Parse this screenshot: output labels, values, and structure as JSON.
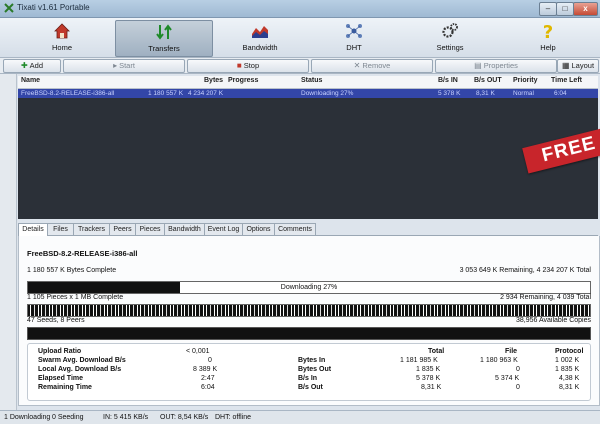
{
  "window": {
    "title": "Tixati v1.61 Portable",
    "min": "–",
    "max": "□",
    "close": "x"
  },
  "toolbar": [
    {
      "key": "home",
      "label": "Home",
      "icon": "home-icon"
    },
    {
      "key": "transfers",
      "label": "Transfers",
      "icon": "transfers-icon",
      "active": true
    },
    {
      "key": "bandwidth",
      "label": "Bandwidth",
      "icon": "bandwidth-icon"
    },
    {
      "key": "dht",
      "label": "DHT",
      "icon": "dht-icon"
    },
    {
      "key": "settings",
      "label": "Settings",
      "icon": "settings-icon"
    },
    {
      "key": "help",
      "label": "Help",
      "icon": "help-icon"
    }
  ],
  "actions": {
    "add": "Add",
    "start": "Start",
    "stop": "Stop",
    "remove": "Remove",
    "properties": "Properties",
    "layout": "Layout"
  },
  "columns": [
    "Name",
    "Bytes",
    "Progress",
    "Status",
    "B/s IN",
    "B/s OUT",
    "Priority",
    "Time Left"
  ],
  "transfers": [
    {
      "name": "FreeBSD-8.2-RELEASE-i386-all",
      "bytes": "1 180 557 K",
      "progress": "4 234 207 K",
      "status": "Downloading 27%",
      "in": "5 378 K",
      "out": "8,31 K",
      "priority": "Normal",
      "time_left": "6:04"
    }
  ],
  "badge": "FREE",
  "tabs": [
    "Details",
    "Files",
    "Trackers",
    "Peers",
    "Pieces",
    "Bandwidth",
    "Event Log",
    "Options",
    "Comments"
  ],
  "active_tab": "Details",
  "details": {
    "name": "FreeBSD-8.2-RELEASE-i386-all",
    "bytes_complete": "1 180 557 K Bytes Complete",
    "bytes_remaining": "3 053 649 K Remaining, 4 234 207 K Total",
    "progress_label": "Downloading 27%",
    "progress": 0.27,
    "pieces_complete": "1 105 Pieces x 1 MB Complete",
    "pieces_remaining": "2 934 Remaining, 4 039 Total",
    "seeds_peers": "47 Seeds, 8 Peers",
    "available_copies": "38,956 Available Copies"
  },
  "stats_left": [
    {
      "label": "Upload Ratio",
      "value": "< 0,001"
    },
    {
      "label": "Swarm Avg. Download B/s",
      "value": "0"
    },
    {
      "label": "Local Avg. Download B/s",
      "value": "8 389 K"
    },
    {
      "label": "Elapsed Time",
      "value": "2:47"
    },
    {
      "label": "Remaining Time",
      "value": "6:04"
    }
  ],
  "stats_headers": {
    "total": "Total",
    "file": "File",
    "protocol": "Protocol"
  },
  "stats_right": [
    {
      "label": "Bytes In",
      "total": "1 181 985 K",
      "file": "1 180 963 K",
      "protocol": "1 002 K"
    },
    {
      "label": "Bytes Out",
      "total": "1 835 K",
      "file": "0",
      "protocol": "1 835 K"
    },
    {
      "label": "B/s In",
      "total": "5 378 K",
      "file": "5 374 K",
      "protocol": "4,38 K"
    },
    {
      "label": "B/s Out",
      "total": "8,31 K",
      "file": "0",
      "protocol": "8,31 K"
    }
  ],
  "status": {
    "downloading": "1 Downloading",
    "seeding": "0 Seeding",
    "in": "IN: 5 415 KB/s",
    "out": "OUT: 8,54 KB/s",
    "dht": "DHT: offline"
  }
}
